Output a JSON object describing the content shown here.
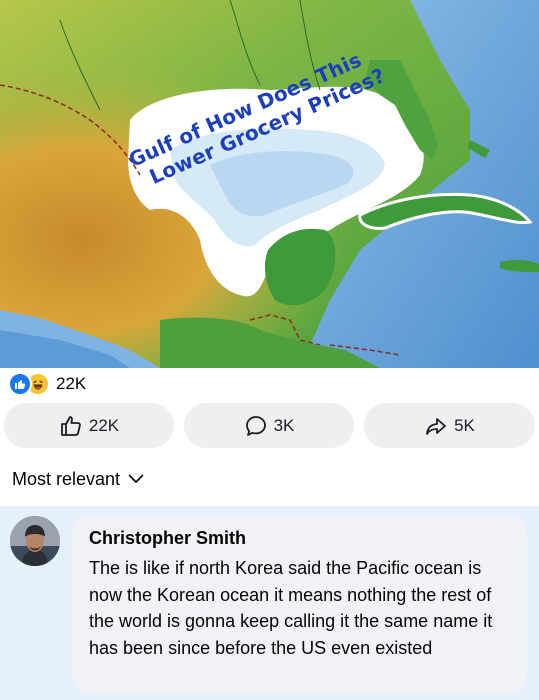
{
  "post": {
    "image": {
      "caption_line1": "Gulf of How Does This",
      "caption_line2": "Lower Grocery Prices?"
    },
    "reactions": {
      "types": [
        "like-icon",
        "haha-icon"
      ],
      "count": "22K"
    },
    "actions": {
      "like_count": "22K",
      "comment_count": "3K",
      "share_count": "5K"
    }
  },
  "comments": {
    "sort_label": "Most relevant",
    "items": [
      {
        "author": "Christopher Smith",
        "text": "The is like if north Korea said the Pacific ocean is now the Korean ocean it means nothing the rest of the world is gonna keep calling it the same name it has been since before the US even existed"
      }
    ]
  },
  "colors": {
    "facebook_blue": "#1877f2",
    "caption_blue": "#1d3fbd",
    "button_bg": "#eeeff1",
    "comment_area_bg": "#e6f0fc",
    "bubble_bg": "#f0f2f5"
  }
}
